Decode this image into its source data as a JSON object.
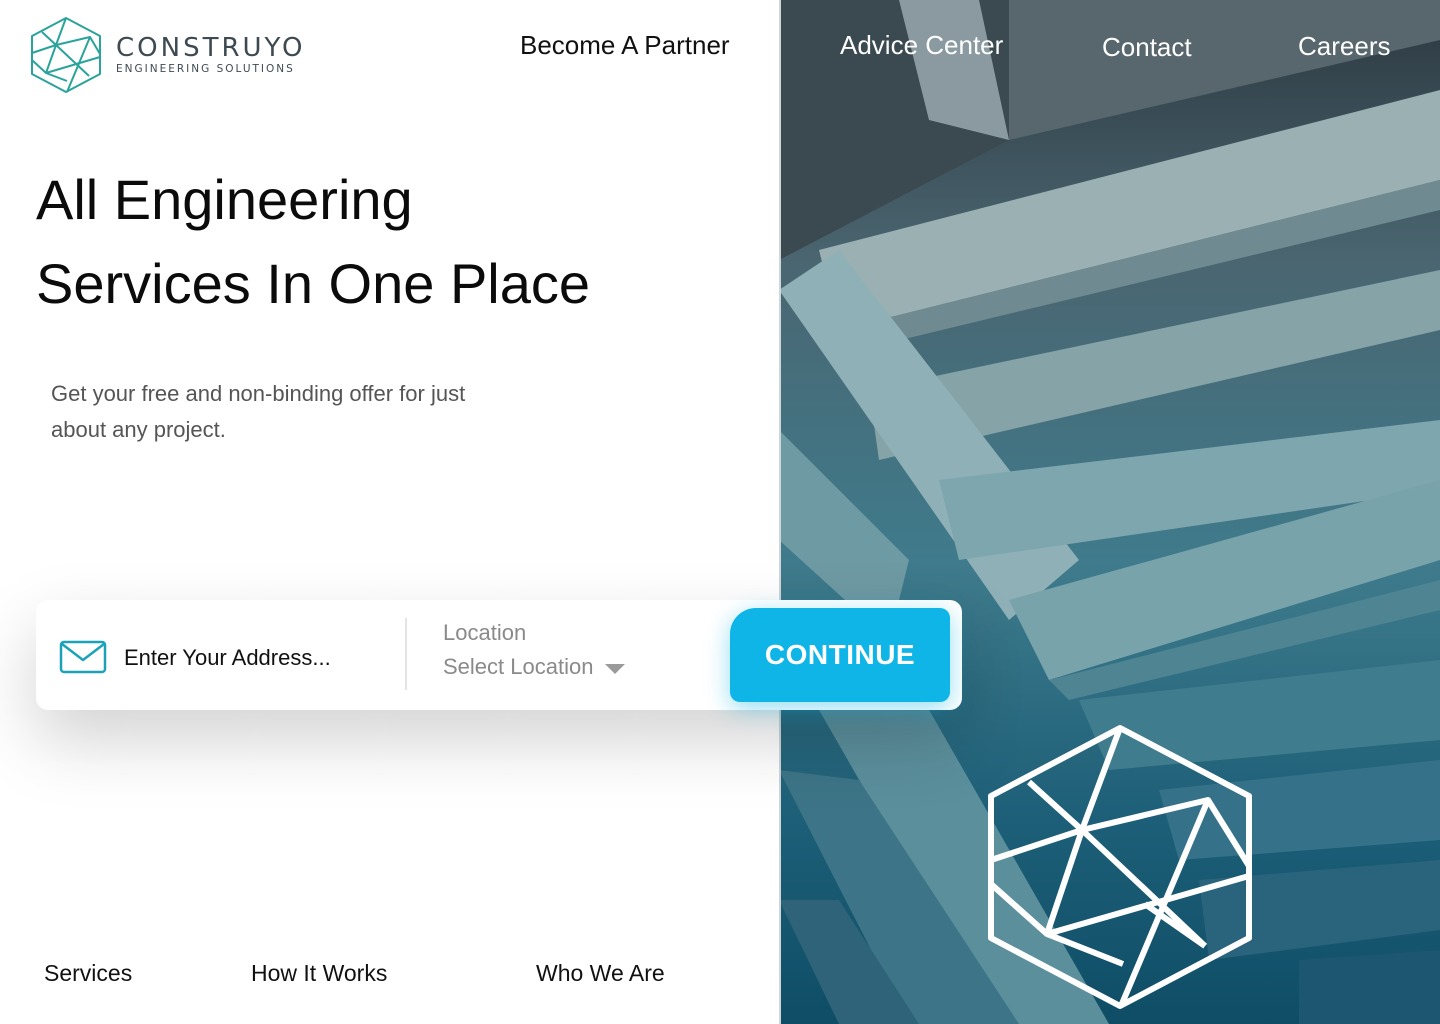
{
  "brand": {
    "name": "CONSTRUYO",
    "tagline": "ENGINEERING SOLUTIONS",
    "accent_color": "#2aa39a"
  },
  "nav": {
    "items": [
      {
        "label": "Become A Partner"
      },
      {
        "label": "Advice Center"
      },
      {
        "label": "Contact"
      },
      {
        "label": "Careers"
      }
    ]
  },
  "hero": {
    "headline_line1": "All Engineering",
    "headline_line2": "Services In One Place",
    "subtext": "Get your free and non-binding offer for just about any project."
  },
  "form": {
    "address_placeholder": "Enter Your Address...",
    "location_label": "Location",
    "location_value": "Select Location",
    "continue_label": "CONTINUE",
    "button_color": "#0fb5e6",
    "icons": {
      "address": "mail-icon",
      "select": "caret-down-icon"
    }
  },
  "bottom_nav": {
    "items": [
      {
        "label": "Services"
      },
      {
        "label": "How It Works"
      },
      {
        "label": "Who We Are"
      }
    ]
  }
}
